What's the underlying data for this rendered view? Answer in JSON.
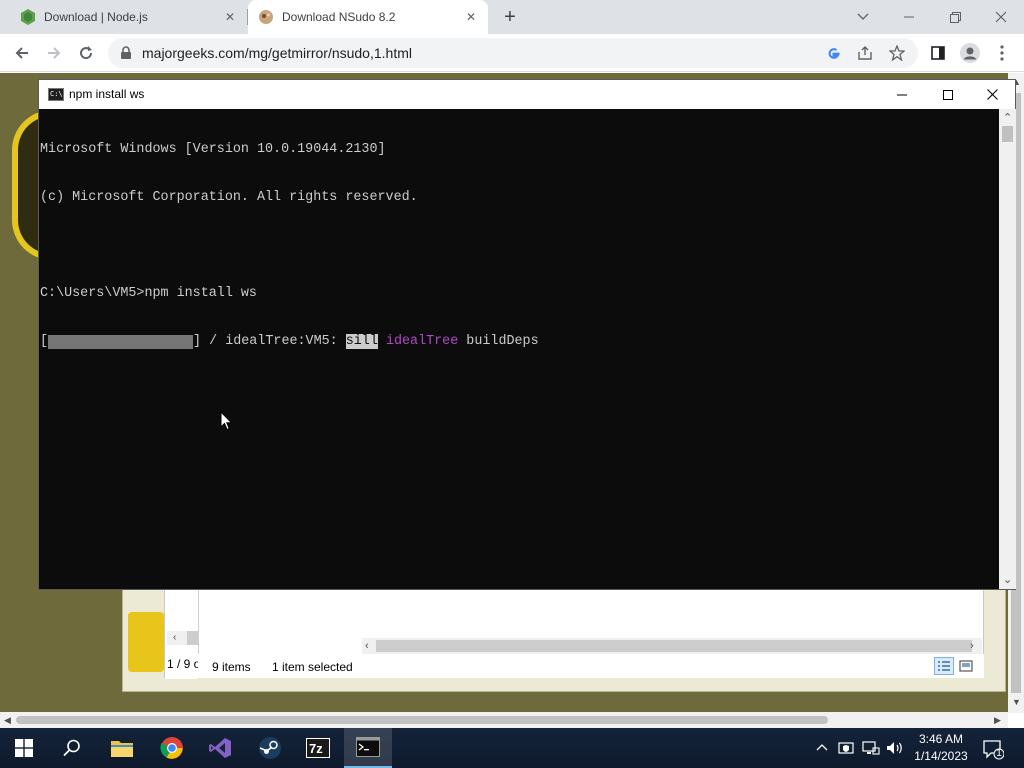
{
  "browser": {
    "tabs": [
      {
        "title": "Download | Node.js",
        "favicon": "nodejs-hexagon-icon",
        "active": false
      },
      {
        "title": "Download NSudo 8.2",
        "favicon": "majorgeeks-icon",
        "active": true
      }
    ],
    "url": "majorgeeks.com/mg/getmirror/nsudo,1.html"
  },
  "console": {
    "title": "npm install ws",
    "lines": [
      "Microsoft Windows [Version 10.0.19044.2130]",
      "(c) Microsoft Corporation. All rights reserved.",
      "",
      "C:\\Users\\VM5>npm install ws"
    ],
    "progress": {
      "open_bracket": "[",
      "close_bracket": "] / idealTree:VM5: ",
      "level": "sill",
      "stage": "idealTree",
      "detail": " buildDeps"
    }
  },
  "explorer": {
    "left_count": "1 / 9 o",
    "items_count": "9 items",
    "selection": "1 item selected"
  },
  "taskbar": {
    "time": "3:46 AM",
    "date": "1/14/2023",
    "notification_count": "1",
    "apps": [
      "start",
      "search",
      "file-explorer",
      "chrome",
      "visual-studio",
      "steam",
      "7-zip",
      "command-prompt"
    ]
  },
  "colors": {
    "console_bg": "#0c0c0c",
    "console_text": "#cccccc",
    "magenta": "#b148c6",
    "taskbar": "#0e1a2c",
    "accent": "#76b9ed"
  }
}
